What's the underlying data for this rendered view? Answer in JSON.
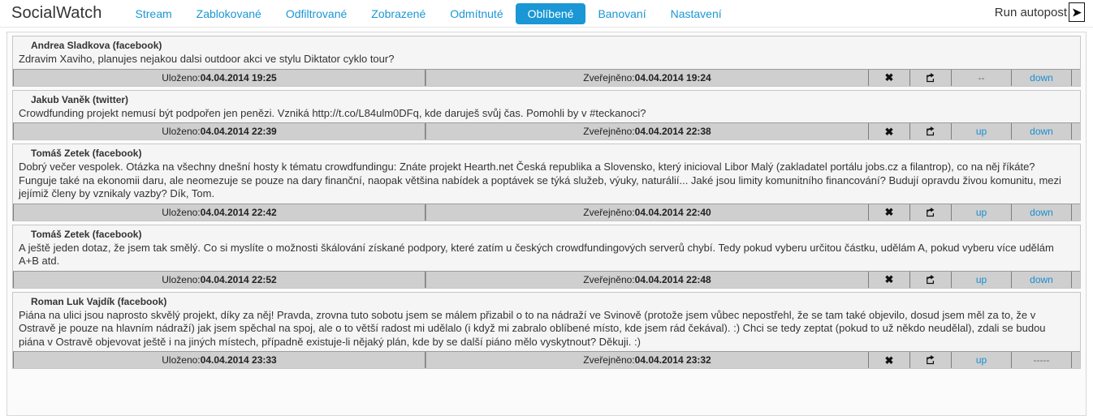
{
  "header": {
    "brand": "SocialWatch",
    "nav": [
      {
        "label": "Stream",
        "active": false
      },
      {
        "label": "Zablokované",
        "active": false
      },
      {
        "label": "Odfiltrované",
        "active": false
      },
      {
        "label": "Zobrazené",
        "active": false
      },
      {
        "label": "Odmítnuté",
        "active": false
      },
      {
        "label": "Oblíbené",
        "active": true
      },
      {
        "label": "Banovaní",
        "active": false
      },
      {
        "label": "Nastavení",
        "active": false
      }
    ],
    "autopost_label": "Run autopost",
    "autopost_button_glyph": "➤",
    "autopost_button_icon": "play-arrow-icon",
    "accent_color": "#1a97d4"
  },
  "labels": {
    "saved": "Uloženo:",
    "published": "Zveřejněno:",
    "delete_icon": "close-x-icon",
    "share_icon": "share-external-icon",
    "delete_glyph": "✖",
    "up": "up",
    "down": "down",
    "up_disabled": "--",
    "down_disabled": "-----"
  },
  "posts": [
    {
      "author": "Andrea Sladkova (facebook)",
      "text": "Zdravim Xaviho, planujes nejakou dalsi outdoor akci ve stylu Diktator cyklo tour?",
      "saved": "04.04.2014 19:25",
      "published": "04.04.2014 19:24",
      "up": "--",
      "down": "down",
      "up_enabled": false,
      "down_enabled": true
    },
    {
      "author": "Jakub Vaněk (twitter)",
      "text": "Crowdfunding projekt nemusí být podpořen jen penězi. Vzniká http://t.co/L84ulm0DFq, kde daruješ svůj čas. Pomohli by v #teckanoci?",
      "saved": "04.04.2014 22:39",
      "published": "04.04.2014 22:38",
      "up": "up",
      "down": "down",
      "up_enabled": true,
      "down_enabled": true
    },
    {
      "author": "Tomáš Zetek (facebook)",
      "text": "Dobrý večer vespolek. Otázka na všechny dnešní hosty k tématu crowdfundingu: Znáte projekt Hearth.net Česká republika a Slovensko, který inicioval Libor Malý (zakladatel portálu jobs.cz a filantrop), co na něj říkáte? Funguje také na ekonomii daru, ale neomezuje se pouze na dary finanční, naopak většina nabídek a poptávek se týká služeb, výuky, naturálií... Jaké jsou limity komunitního financování? Budují opravdu živou komunitu, mezi jejímiž členy by vznikaly vazby? Dík, Tom.",
      "saved": "04.04.2014 22:42",
      "published": "04.04.2014 22:40",
      "up": "up",
      "down": "down",
      "up_enabled": true,
      "down_enabled": true
    },
    {
      "author": "Tomáš Zetek (facebook)",
      "text": "A ještě jeden dotaz, že jsem tak smělý. Co si myslíte o možnosti škálování získané podpory, které zatím u českých crowdfundingových serverů chybí. Tedy pokud vyberu určitou částku, udělám A, pokud vyberu více udělám A+B atd.",
      "saved": "04.04.2014 22:52",
      "published": "04.04.2014 22:48",
      "up": "up",
      "down": "down",
      "up_enabled": true,
      "down_enabled": true
    },
    {
      "author": "Roman Luk Vajdík (facebook)",
      "text": "Piána na ulici jsou naprosto skvělý projekt, díky za něj! Pravda, zrovna tuto sobotu jsem se málem přizabil o to na nádraží ve Svinově (protože jsem vůbec nepostřehl, že se tam také objevilo, dosud jsem měl za to, že v Ostravě je pouze na hlavním nádraží) jak jsem spěchal na spoj, ale o to větší radost mi udělalo (i když mi zabralo oblíbené místo, kde jsem rád čekával). :) Chci se tedy zeptat (pokud to už někdo neudělal), zdali se budou piána v Ostravě objevovat ještě i na jiných místech, případně existuje-li nějaký plán, kde by se další piáno mělo vyskytnout? Děkuji. :)",
      "saved": "04.04.2014 23:33",
      "published": "04.04.2014 23:32",
      "up": "up",
      "down": "-----",
      "up_enabled": true,
      "down_enabled": false
    }
  ]
}
